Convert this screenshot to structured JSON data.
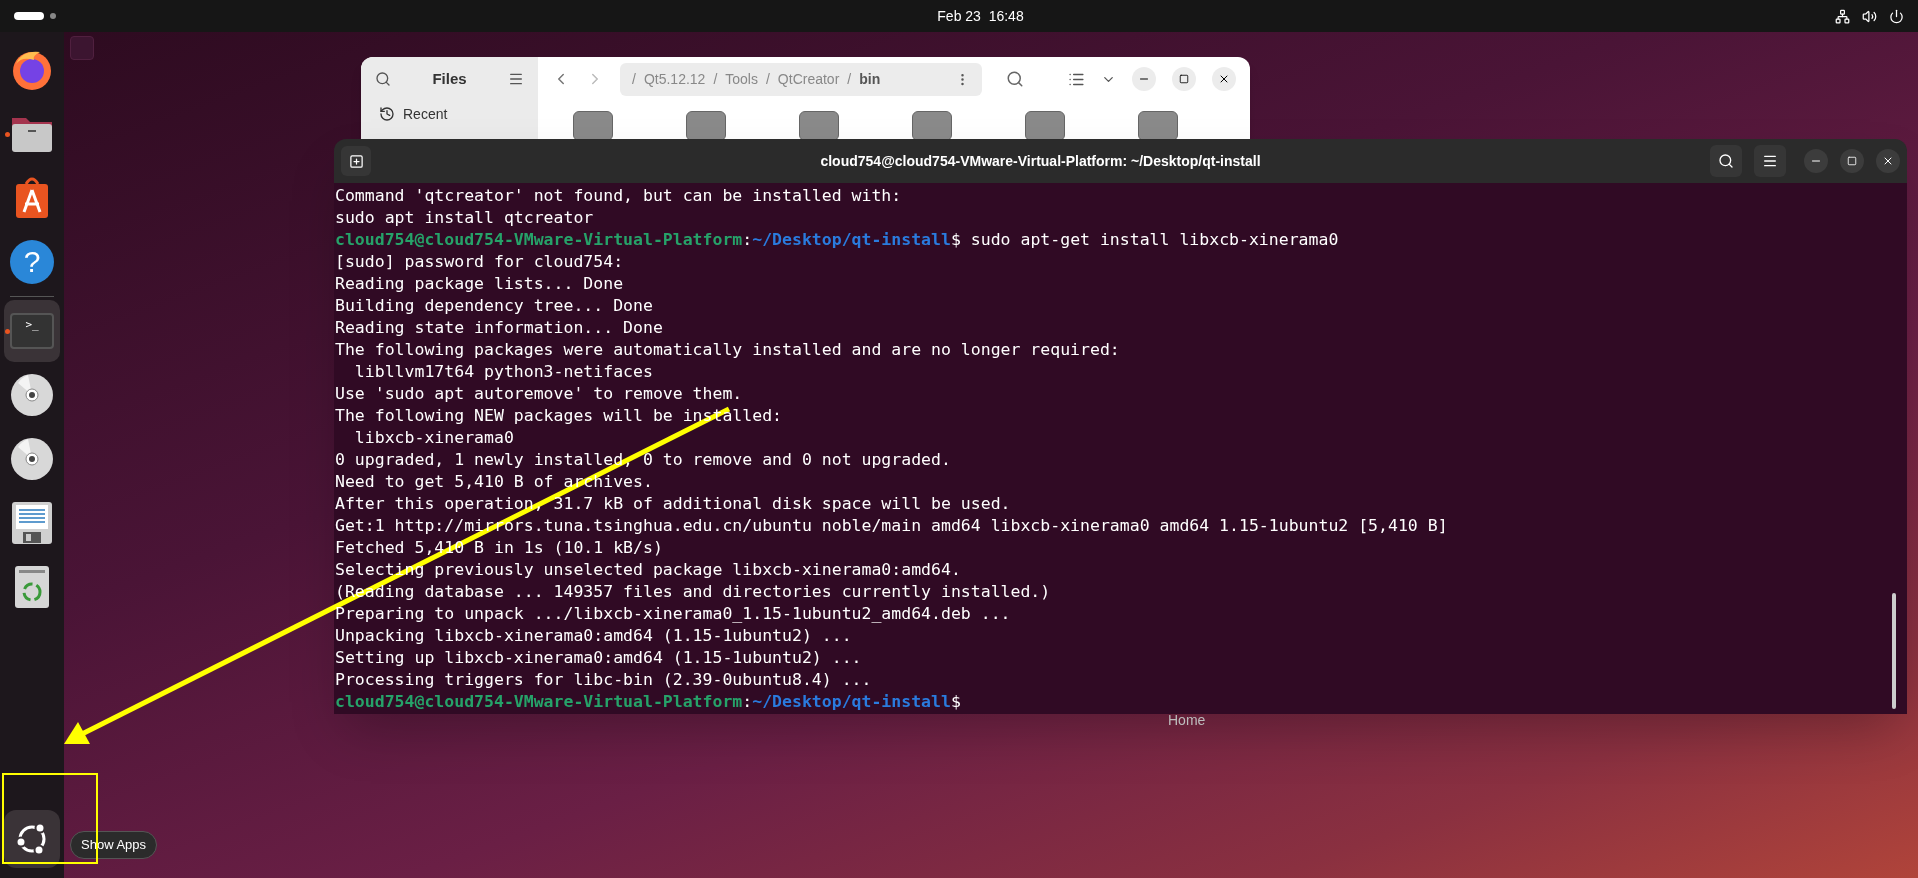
{
  "top_bar": {
    "clock": "Feb 23  16:48"
  },
  "dock": {
    "items": [
      {
        "kind": "browser",
        "running": false,
        "selected": false
      },
      {
        "kind": "folder",
        "running": true,
        "selected": false
      },
      {
        "kind": "store",
        "running": false,
        "selected": false
      },
      {
        "kind": "help",
        "glyph": "?",
        "running": false,
        "selected": false
      },
      {
        "kind": "terminal",
        "glyph": ">_",
        "running": true,
        "selected": true
      },
      {
        "kind": "disc",
        "running": false,
        "selected": false
      },
      {
        "kind": "disc",
        "running": false,
        "selected": false
      },
      {
        "kind": "document",
        "running": false,
        "selected": false
      },
      {
        "kind": "trash",
        "running": false,
        "selected": false
      }
    ],
    "show_apps_tooltip": "Show Apps"
  },
  "desktop": {
    "icon_label": "Home"
  },
  "files_window": {
    "title": "Files",
    "sidebar": [
      {
        "label": "Recent"
      }
    ],
    "path": [
      {
        "separator": "/",
        "label": "Qt5.12.12"
      },
      {
        "separator": "/",
        "label": "Tools"
      },
      {
        "separator": "/",
        "label": "QtCreator"
      },
      {
        "separator": "/",
        "label": "bin"
      }
    ],
    "folders": [
      {
        "kind": "folder"
      },
      {
        "kind": "folder"
      },
      {
        "kind": "folder"
      },
      {
        "kind": "folder"
      },
      {
        "kind": "folder"
      },
      {
        "kind": "folder"
      }
    ]
  },
  "terminal": {
    "title": "cloud754@cloud754-VMware-Virtual-Platform: ~/Desktop/qt-install",
    "lines": [
      {
        "kind": "output",
        "text": "Command 'qtcreator' not found, but can be installed with:"
      },
      {
        "kind": "output",
        "text": "sudo apt install qtcreator"
      },
      {
        "kind": "prompt",
        "parts": [
          {
            "kind": "user",
            "text": "cloud754@cloud754-VMware-Virtual-Platform"
          },
          {
            "kind": "plain",
            "text": ":"
          },
          {
            "kind": "path",
            "text": "~/Desktop/qt-install"
          },
          {
            "kind": "plain",
            "text": "$ sudo apt-get install libxcb-xinerama0"
          }
        ]
      },
      {
        "kind": "output",
        "text": "[sudo] password for cloud754:"
      },
      {
        "kind": "output",
        "text": "Reading package lists... Done"
      },
      {
        "kind": "output",
        "text": "Building dependency tree... Done"
      },
      {
        "kind": "output",
        "text": "Reading state information... Done"
      },
      {
        "kind": "output",
        "text": "The following packages were automatically installed and are no longer required:"
      },
      {
        "kind": "output",
        "text": "  libllvm17t64 python3-netifaces"
      },
      {
        "kind": "output",
        "text": "Use 'sudo apt autoremove' to remove them."
      },
      {
        "kind": "output",
        "text": "The following NEW packages will be installed:"
      },
      {
        "kind": "output",
        "text": "  libxcb-xinerama0"
      },
      {
        "kind": "output",
        "text": "0 upgraded, 1 newly installed, 0 to remove and 0 not upgraded."
      },
      {
        "kind": "output",
        "text": "Need to get 5,410 B of archives."
      },
      {
        "kind": "output",
        "text": "After this operation, 31.7 kB of additional disk space will be used."
      },
      {
        "kind": "output",
        "text": "Get:1 http://mirrors.tuna.tsinghua.edu.cn/ubuntu noble/main amd64 libxcb-xinerama0 amd64 1.15-1ubuntu2 [5,410 B]"
      },
      {
        "kind": "output",
        "text": "Fetched 5,410 B in 1s (10.1 kB/s)"
      },
      {
        "kind": "output",
        "text": "Selecting previously unselected package libxcb-xinerama0:amd64."
      },
      {
        "kind": "output",
        "text": "(Reading database ... 149357 files and directories currently installed.)"
      },
      {
        "kind": "output",
        "text": "Preparing to unpack .../libxcb-xinerama0_1.15-1ubuntu2_amd64.deb ..."
      },
      {
        "kind": "output",
        "text": "Unpacking libxcb-xinerama0:amd64 (1.15-1ubuntu2) ..."
      },
      {
        "kind": "output",
        "text": "Setting up libxcb-xinerama0:amd64 (1.15-1ubuntu2) ..."
      },
      {
        "kind": "output",
        "text": "Processing triggers for libc-bin (2.39-0ubuntu8.4) ..."
      },
      {
        "kind": "prompt",
        "parts": [
          {
            "kind": "user",
            "text": "cloud754@cloud754-VMware-Virtual-Platform"
          },
          {
            "kind": "plain",
            "text": ":"
          },
          {
            "kind": "path",
            "text": "~/Desktop/qt-install"
          },
          {
            "kind": "plain",
            "text": "$"
          }
        ]
      }
    ]
  }
}
